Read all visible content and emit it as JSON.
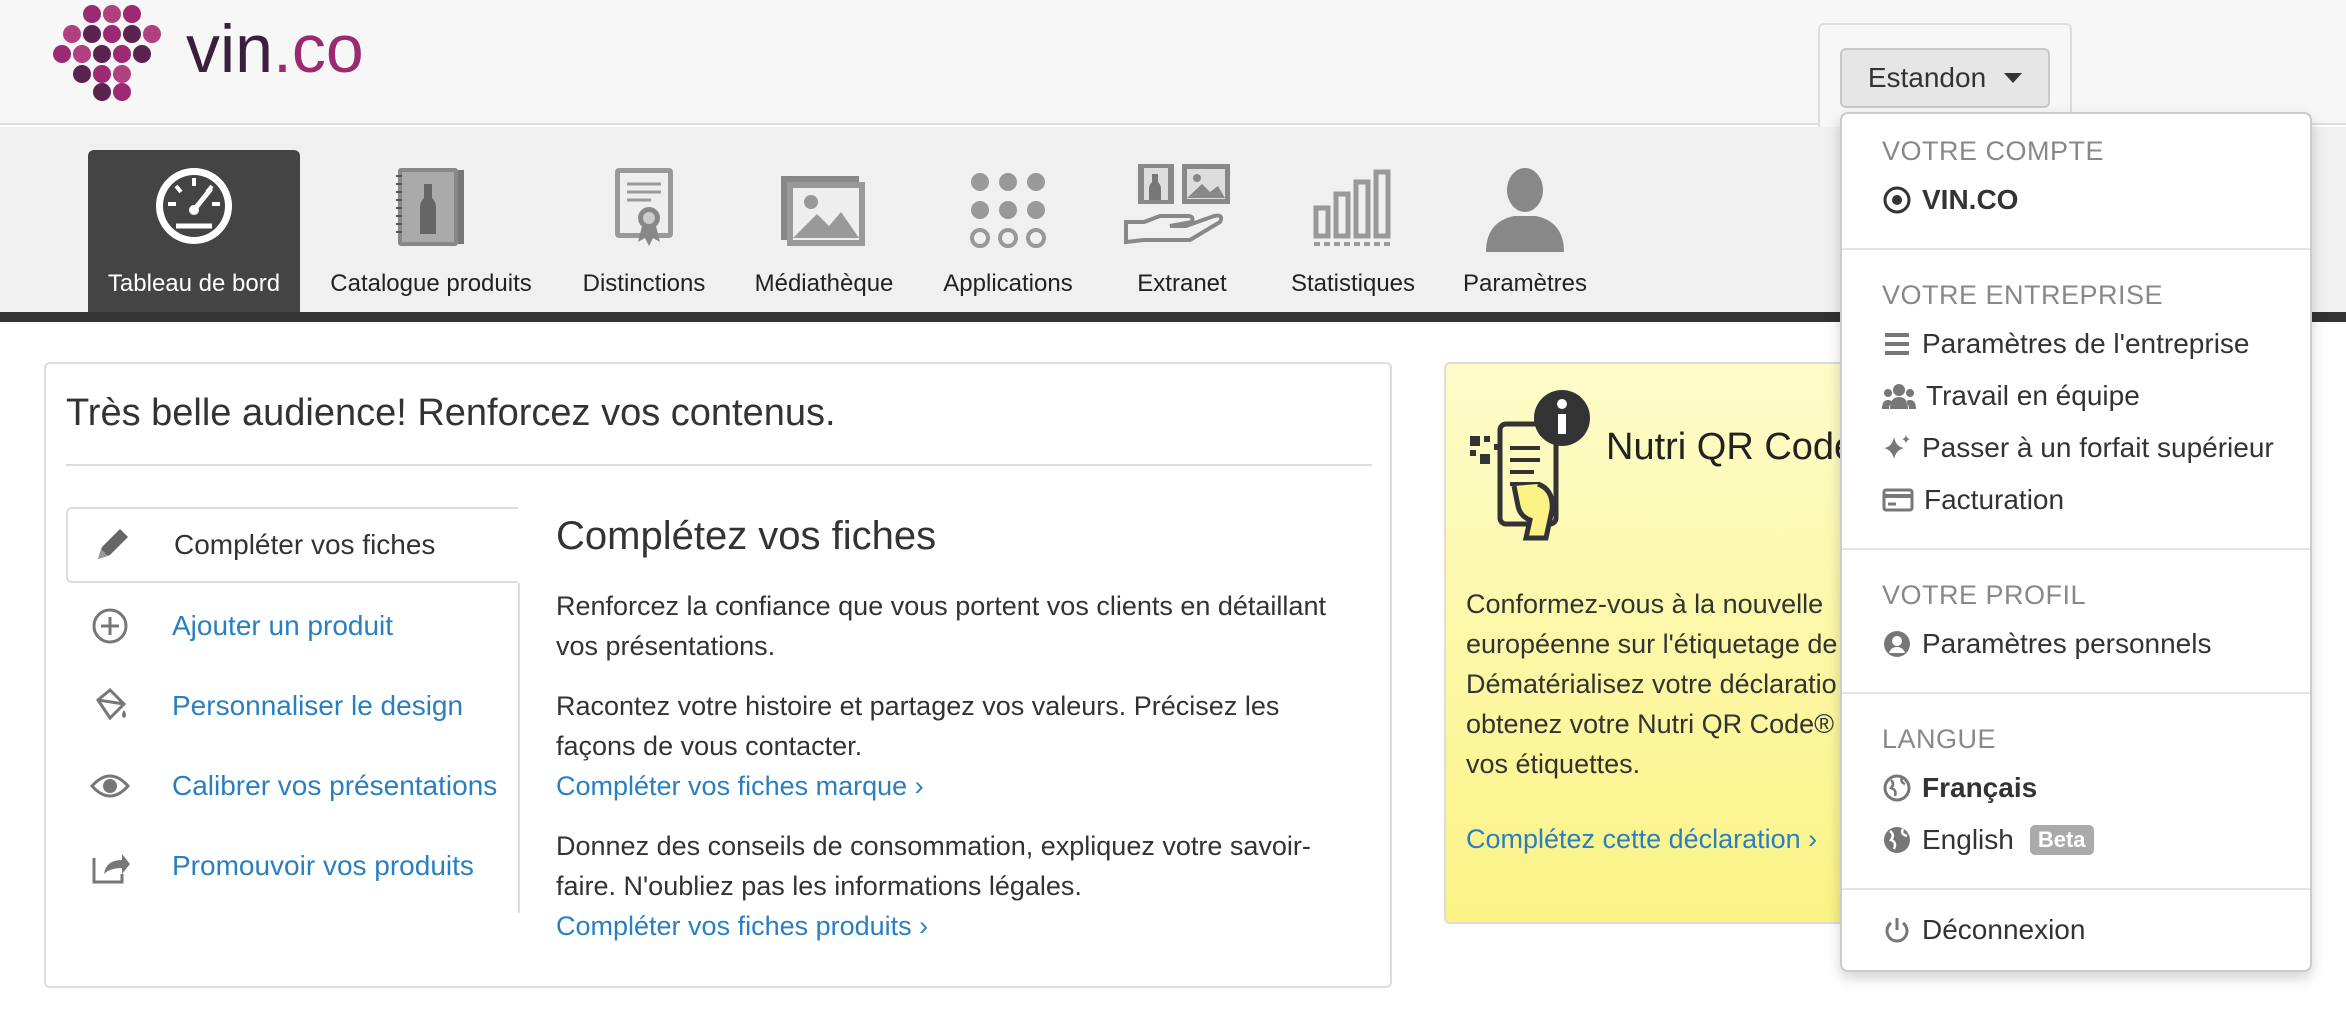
{
  "header": {
    "logo": {
      "text_main": "vin",
      "text_accent": ".co"
    },
    "account_button": "Estandon"
  },
  "nav": [
    {
      "label": "Tableau de bord",
      "icon": "dashboard-icon",
      "active": true
    },
    {
      "label": "Catalogue produits",
      "icon": "catalog-icon"
    },
    {
      "label": "Distinctions",
      "icon": "certificate-icon"
    },
    {
      "label": "Médiathèque",
      "icon": "image-icon"
    },
    {
      "label": "Applications",
      "icon": "apps-grid-icon"
    },
    {
      "label": "Extranet",
      "icon": "extranet-icon"
    },
    {
      "label": "Statistiques",
      "icon": "stats-icon"
    },
    {
      "label": "Paramètres",
      "icon": "user-icon"
    }
  ],
  "panel": {
    "title": "Très belle audience! Renforcez vos contenus.",
    "side": [
      {
        "label": "Compléter vos fiches",
        "icon": "pencil-icon",
        "active": true
      },
      {
        "label": "Ajouter un produit",
        "icon": "plus-circle-icon"
      },
      {
        "label": "Personnaliser le design",
        "icon": "paint-bucket-icon"
      },
      {
        "label": "Calibrer vos présentations",
        "icon": "eye-icon"
      },
      {
        "label": "Promouvoir vos produits",
        "icon": "share-icon"
      }
    ],
    "content": {
      "heading": "Complétez vos fiches",
      "p1": "Renforcez la confiance que vous portent vos clients en détaillant vos présentations.",
      "p2": "Racontez votre histoire et partagez vos valeurs. Précisez les façons de vous contacter.",
      "link1": "Compléter vos fiches marque ›",
      "p3": "Donnez des conseils de consommation, expliquez votre savoir-faire. N'oubliez pas les informations légales.",
      "link2": "Compléter vos fiches produits ›"
    }
  },
  "card": {
    "title": "Nutri QR Code",
    "lines": [
      "Conformez-vous à la nouvelle",
      "européenne sur l'étiquetage de",
      "Dématérialisez votre déclaratio",
      "obtenez votre Nutri QR Code®",
      "vos étiquettes."
    ],
    "link": "Complétez cette déclaration ›"
  },
  "dropdown": {
    "h_compte": "VOTRE COMPTE",
    "compte_item": "VIN.CO",
    "h_entreprise": "VOTRE ENTREPRISE",
    "ent_items": [
      "Paramètres de l'entreprise",
      "Travail en équipe",
      "Passer à un forfait supérieur",
      "Facturation"
    ],
    "h_profil": "VOTRE PROFIL",
    "profil_item": "Paramètres personnels",
    "h_langue": "LANGUE",
    "lang_fr": "Français",
    "lang_en": "English",
    "beta": "Beta",
    "logout": "Déconnexion"
  },
  "colors": {
    "link": "#2a7fc1",
    "brand": "#9b2a73",
    "nav_active": "#444444",
    "card_yellow": "#fbf385"
  }
}
